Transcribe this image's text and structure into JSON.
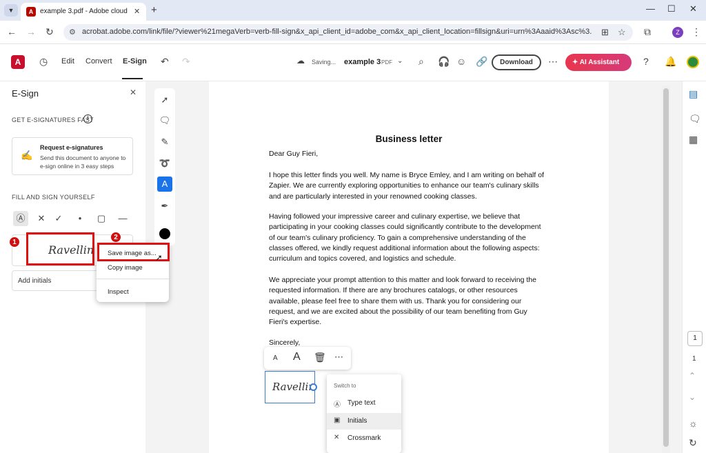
{
  "browser": {
    "tab_title": "example 3.pdf - Adobe cloud st",
    "url": "acrobat.adobe.com/link/file/?viewer%21megaVerb=verb-fill-sign&x_api_client_id=adobe_com&x_api_client_location=fillsign&uri=urn%3Aaaid%3Asc%3...",
    "profile_initial": "Z"
  },
  "toolbar": {
    "menu": [
      "Edit",
      "Convert",
      "E-Sign"
    ],
    "saving": "Saving...",
    "doc_name": "example 3",
    "doc_type": "PDF",
    "download": "Download",
    "ai_assistant": "AI Assistant"
  },
  "panel": {
    "title": "E-Sign",
    "get_fast": "GET E-SIGNATURES FAST",
    "request_title": "Request e-signatures",
    "request_desc": "Send this document to anyone to e-sign online in 3 easy steps",
    "fill_sign": "FILL AND SIGN YOURSELF",
    "signature_text": "Ravellin",
    "add_initials": "Add initials"
  },
  "context_menu": {
    "save_image": "Save image as...",
    "copy_image": "Copy image",
    "inspect": "Inspect"
  },
  "markers": [
    "1",
    "2"
  ],
  "letter": {
    "title": "Business letter",
    "greeting": "Dear Guy Fieri,",
    "p1": "I hope this letter finds you well. My name is Bryce Emley, and I am writing on behalf of Zapier. We are currently exploring opportunities to enhance our team's culinary skills and are particularly interested in your renowned cooking classes.",
    "p2": "Having followed your impressive career and culinary expertise, we believe that participating in your cooking classes could significantly contribute to the development of our team's culinary proficiency. To gain a comprehensive understanding of the classes offered, we kindly request additional information about the following aspects: curriculum and topics covered, and logistics and schedule.",
    "p3": "We appreciate your prompt attention to this matter and look forward to receiving the requested information. If there are any brochures catalogs, or other resources available, please feel free to share them with us. Thank you for considering our request, and we are excited about the possibility of our team benefiting from Guy Fieri's expertise.",
    "closing": "Sincerely,",
    "signature": "Ravellin"
  },
  "switch_menu": {
    "title": "Switch to",
    "items": [
      "Type text",
      "Initials",
      "Crossmark"
    ]
  },
  "pagination": {
    "current": "1",
    "total": "1"
  },
  "colors": {
    "accent": "#1a73e8",
    "highlight_red": "#e01010",
    "acrobat_red": "#c8102e"
  }
}
